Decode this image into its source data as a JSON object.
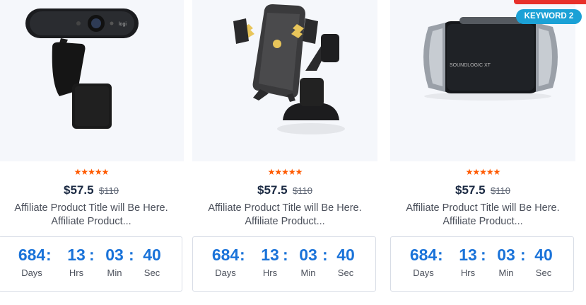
{
  "products": [
    {
      "image": "webcam-image",
      "stars": "★★★★★",
      "price": "$57.5",
      "old_price": "$110",
      "title": "Affiliate Product Title will Be Here. Affiliate Product...",
      "countdown": {
        "days": "684",
        "hrs": "13",
        "min": "03",
        "sec": "40"
      }
    },
    {
      "image": "phone-mount-image",
      "stars": "★★★★★",
      "price": "$57.5",
      "old_price": "$110",
      "title": "Affiliate Product Title will Be Here. Affiliate Product...",
      "countdown": {
        "days": "684",
        "hrs": "13",
        "min": "03",
        "sec": "40"
      }
    },
    {
      "image": "speaker-image",
      "stars": "★★★★★",
      "price": "$57.5",
      "old_price": "$110",
      "title": "Affiliate Product Title will Be Here. Affiliate Product...",
      "countdown": {
        "days": "684",
        "hrs": "13",
        "min": "03",
        "sec": "40"
      }
    }
  ],
  "labels": {
    "days": "Days",
    "hrs": "Hrs",
    "min": "Min",
    "sec": "Sec",
    "colon": ":"
  },
  "badges": {
    "keyword": "KEYWORD 2"
  },
  "colors": {
    "star": "#ff5a00",
    "countdown_number": "#1a73d9",
    "price": "#1a2942",
    "badge_red": "#e8302a",
    "badge_keyword": "#1ba1d6"
  }
}
